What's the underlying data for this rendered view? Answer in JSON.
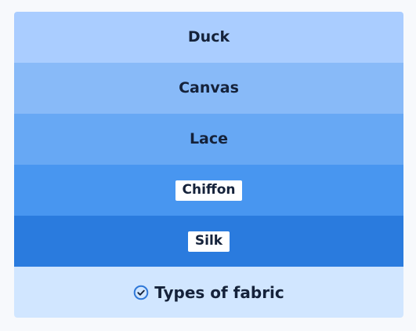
{
  "diagram": {
    "title": "Types of fabric",
    "footer_icon": "check-circle-icon",
    "layers": [
      {
        "label": "Duck",
        "color": "#aacdff",
        "boxed": false
      },
      {
        "label": "Canvas",
        "color": "#88baf8",
        "boxed": false
      },
      {
        "label": "Lace",
        "color": "#67a8f4",
        "boxed": false
      },
      {
        "label": "Chiffon",
        "color": "#4896f0",
        "boxed": true
      },
      {
        "label": "Silk",
        "color": "#2a7bde",
        "boxed": true
      }
    ],
    "footer_color": "#d1e6ff",
    "icon_color": "#2f78d8"
  }
}
